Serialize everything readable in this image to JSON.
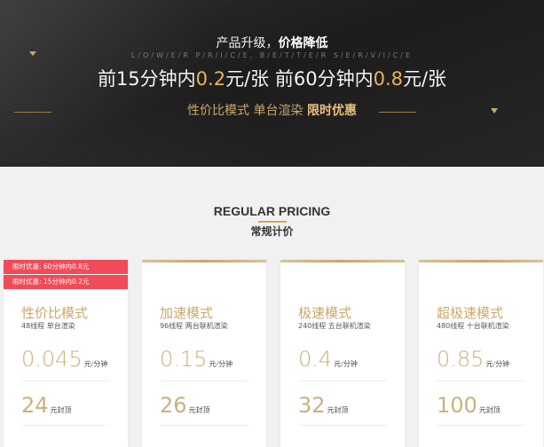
{
  "hero": {
    "title_normal": "产品升级，",
    "title_bold": "价格降低",
    "subtitle": "L/O/W/E/R P/R/I/C/E, B/E/T/T/E/R S/E/R/V/I/C/E",
    "offer_a_pre": "前15分钟内",
    "offer_a_price": "0.2",
    "offer_a_post": "元/张",
    "offer_b_pre": "前60分钟内",
    "offer_b_price": "0.8",
    "offer_b_post": "元/张",
    "mode_text": "性价比模式  单台渲染 ",
    "mode_bold": "限时优惠"
  },
  "section": {
    "title": "REGULAR PRICING",
    "subtitle": "常规计价"
  },
  "cards": [
    {
      "name": "性价比模式",
      "desc": "48线程 单台渲染",
      "price": "0.045",
      "price_unit": "元/分钟",
      "cap": "24",
      "cap_unit": "元封顶",
      "promos": [
        "限时优惠: 60分钟内0.8元",
        "限时优惠: 15分钟内0.2元"
      ]
    },
    {
      "name": "加速模式",
      "desc": "96线程 两台联机渲染",
      "price": "0.15",
      "price_unit": "元/分钟",
      "cap": "26",
      "cap_unit": "元封顶"
    },
    {
      "name": "极速模式",
      "desc": "240线程 五台联机渲染",
      "price": "0.4",
      "price_unit": "元/分钟",
      "cap": "32",
      "cap_unit": "元封顶"
    },
    {
      "name": "超极速模式",
      "desc": "480线程 十台联机渲染",
      "price": "0.85",
      "price_unit": "元/分钟",
      "cap": "100",
      "cap_unit": "元封顶"
    }
  ],
  "colors": {
    "gold": "#c9a86a",
    "promo_red": "#f24a58",
    "hero_bg": "#232323"
  }
}
